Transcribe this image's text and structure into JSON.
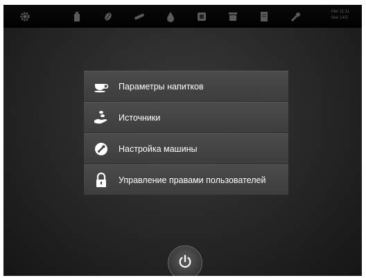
{
  "topbar": {
    "icons": [
      "gear-icon",
      "bottle-icon",
      "bean-icon",
      "dispenser-icon",
      "drop-icon",
      "filter-icon",
      "cup-stack-icon",
      "document-icon",
      "wrench-icon"
    ],
    "clock_line1": "Mer 11:11",
    "clock_line2": "Mar 14/5"
  },
  "menu": {
    "items": [
      {
        "label": "Параметры напитков",
        "icon": "cup-icon"
      },
      {
        "label": "Источники",
        "icon": "hand-beans-icon"
      },
      {
        "label": "Настройка машины",
        "icon": "machine-settings-icon"
      },
      {
        "label": "Управление правами пользователей",
        "icon": "lock-icon"
      }
    ]
  },
  "power": {
    "icon": "power-icon"
  }
}
